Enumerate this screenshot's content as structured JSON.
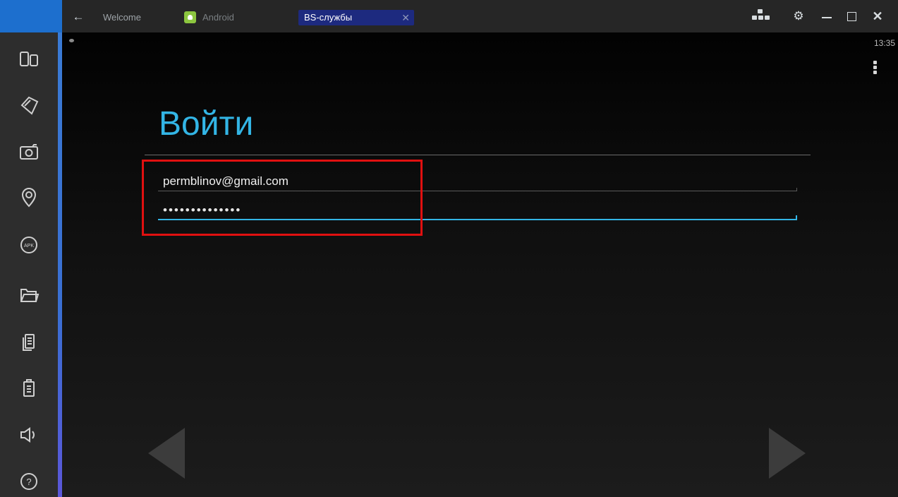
{
  "tabs": {
    "welcome": "Welcome",
    "android": "Android",
    "active": "BS-службы",
    "active_close": "✕"
  },
  "window": {
    "back": "←",
    "settings": "⚙",
    "close": "✕"
  },
  "status_bar": {
    "time": "13:35"
  },
  "signin": {
    "title": "Войти",
    "email": "permblinov@gmail.com",
    "password": "••••••••••••••"
  },
  "colors": {
    "accent": "#33b5e5",
    "tab_active": "#1d2a7f",
    "highlight": "#e01010",
    "sidebar": "#2d2d2d",
    "brand": "#1d6fce"
  },
  "icons": {
    "sidebar": [
      "rotate-screen-icon",
      "shake-icon",
      "camera-icon",
      "location-icon",
      "apk-icon",
      "folder-icon",
      "copy-icon",
      "paste-icon",
      "volume-icon",
      "help-icon"
    ]
  }
}
